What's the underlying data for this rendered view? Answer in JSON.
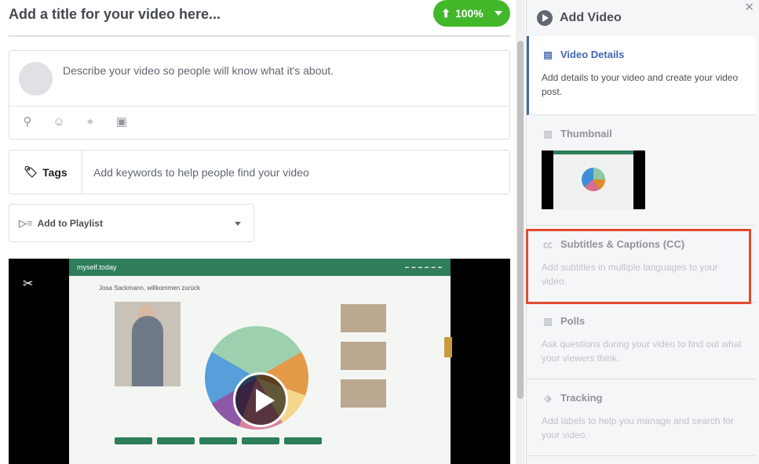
{
  "composer": {
    "title_placeholder": "Add a title for your video here...",
    "upload_progress": "100%",
    "description_placeholder": "Describe your video so people will know what it's about.",
    "description_icons": [
      "tag-people-icon",
      "feeling-icon",
      "location-icon",
      "sticker-icon"
    ],
    "tags_label": "Tags",
    "tags_placeholder": "Add keywords to help people find your video",
    "playlist_label": "Add to Playlist",
    "video_preview": {
      "site_logo": "myself.today",
      "greeting": "Josa Sackmann, willkommen zurück"
    }
  },
  "sidebar": {
    "title": "Add Video",
    "sections": [
      {
        "title": "Video Details",
        "description": "Add details to your video and create your video post.",
        "icon": "details-icon",
        "active": true
      },
      {
        "title": "Thumbnail",
        "description": "",
        "icon": "image-icon",
        "active": false
      },
      {
        "title": "Subtitles & Captions (CC)",
        "description": "Add subtitles in multiple languages to your video.",
        "icon": "cc-icon",
        "active": false
      },
      {
        "title": "Polls",
        "description": "Ask questions during your video to find out what your viewers think.",
        "icon": "poll-icon",
        "active": false
      },
      {
        "title": "Tracking",
        "description": "Add labels to help you manage and search for your video.",
        "icon": "tag-icon",
        "active": false
      }
    ]
  },
  "colors": {
    "accent": "#4267b2",
    "upload_green": "#42b72a",
    "highlight": "#e24a33"
  }
}
